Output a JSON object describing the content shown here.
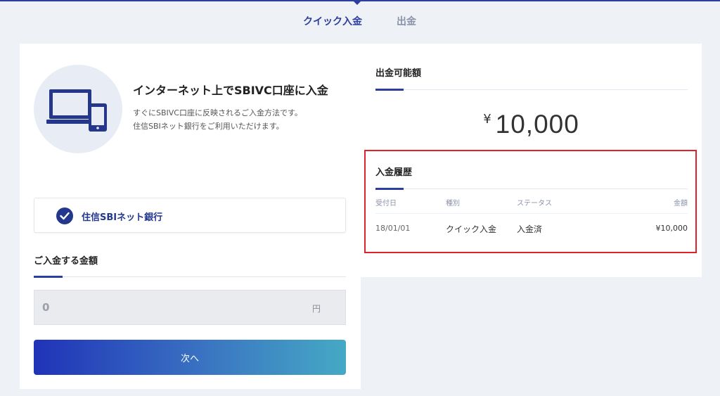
{
  "tabs": [
    {
      "label": "クイック入金",
      "active": true
    },
    {
      "label": "出金",
      "active": false
    }
  ],
  "intro": {
    "title": "インターネット上でSBIVC口座に入金",
    "line1": "すぐにSBIVC口座に反映されるご入金方法です。",
    "line2": "住信SBIネット銀行をご利用いただけます。",
    "icon": "laptop-phone-icon"
  },
  "bank": {
    "label": "住信SBIネット銀行",
    "selected": true,
    "icon": "check-circle-icon"
  },
  "deposit": {
    "heading": "ご入金する金額",
    "placeholder": "0",
    "unit": "円",
    "next_label": "次へ"
  },
  "available": {
    "heading": "出金可能額",
    "currency": "¥",
    "amount": "10,000"
  },
  "history": {
    "heading": "入金履歴",
    "columns": [
      "受付日",
      "種別",
      "ステータス",
      "金額"
    ],
    "rows": [
      {
        "date": "18/01/01",
        "type": "クイック入金",
        "status": "入金済",
        "amount": "¥10,000"
      }
    ]
  },
  "colors": {
    "accent": "#2c3e9e",
    "highlight": "#e0202a",
    "background": "#eef1f6"
  }
}
